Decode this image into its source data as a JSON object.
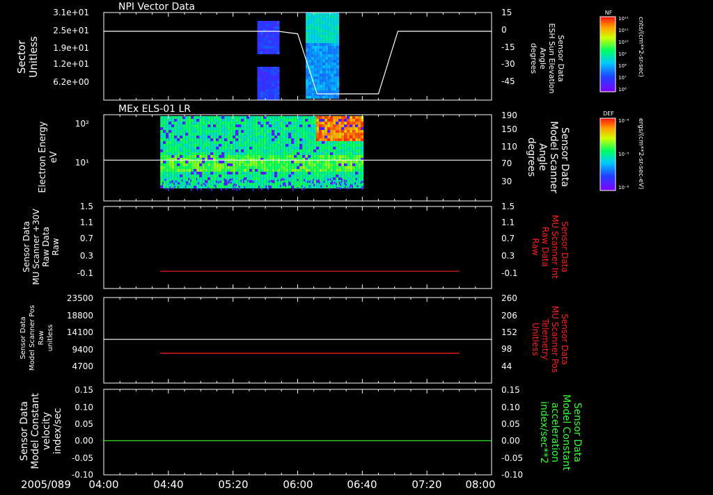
{
  "date_label": "2005/089",
  "colors": {
    "axis": "#ffffff",
    "red_trace": "#ff2020",
    "green_trace": "#33ff33",
    "white_trace": "#ffffff",
    "background": "#000000"
  },
  "chart_data": [
    {
      "id": "panel1",
      "type": "heatmap",
      "title": "NPI Vector Data",
      "ylabel_left": [
        "Sector",
        "Unitless"
      ],
      "ylabel_right": [
        "Sensor Data",
        "ESH Sun Elevation",
        "Angle",
        "degrees"
      ],
      "y_left_ticks": [
        "3.1e+01",
        "2.5e+01",
        "1.9e+01",
        "1.2e+01",
        "6.2e+00"
      ],
      "y_right_ticks": [
        "15",
        "0",
        "-15",
        "-30",
        "-45"
      ],
      "y_right_range": [
        -55,
        15
      ],
      "colorbar": {
        "tag": "NF",
        "unit": "cnts/(cm**2-sr-sec)",
        "ticks": [
          "10¹²",
          "10¹¹",
          "10¹⁰",
          "10⁹",
          "10⁸",
          "10⁷",
          "10⁶"
        ]
      },
      "line_series": {
        "name": "ESH Sun Elevation Angle",
        "x": [
          "04:00",
          "05:48",
          "06:00",
          "06:12",
          "06:50",
          "07:02",
          "08:00"
        ],
        "y": [
          0,
          0,
          -2,
          -50,
          -50,
          0,
          0
        ]
      }
    },
    {
      "id": "panel2",
      "type": "heatmap",
      "title": "MEx ELS-01 LR",
      "ylabel_left": [
        "Electron Energy",
        "eV"
      ],
      "ylabel_right": [
        "Sensor Data",
        "Model Scanner",
        "Angle",
        "degrees"
      ],
      "y_left_ticks": [
        "10²",
        "10¹"
      ],
      "y_left_scale": "log",
      "y_right_ticks": [
        "190",
        "150",
        "110",
        "70",
        "30"
      ],
      "y_right_range": [
        0,
        190
      ],
      "colorbar": {
        "tag": "DEF",
        "unit": "ergs/(cm**2-sr-sec-eV)",
        "ticks": [
          "10⁻⁴",
          "10⁻⁵",
          "10⁻⁶"
        ]
      },
      "line_series": {
        "name": "Model Scanner Angle",
        "x": [
          "04:00",
          "08:00"
        ],
        "y": [
          90,
          90
        ]
      }
    },
    {
      "id": "panel3",
      "type": "line",
      "ylabel_left": [
        "Sensor Data",
        "MU Scanner +30V",
        "Raw Data",
        "Raw"
      ],
      "ylabel_right": [
        "Sensor Data",
        "MU Scanner Int",
        "Raw Data",
        "Raw"
      ],
      "y_left_ticks": [
        "1.5",
        "1.1",
        "0.7",
        "0.3",
        "-0.1"
      ],
      "y_right_ticks": [
        "1.5",
        "1.1",
        "0.7",
        "0.3",
        "-0.1"
      ],
      "ylim": [
        -0.4,
        1.5
      ],
      "series": [
        {
          "color": "red",
          "x": [
            "04:35",
            "07:40"
          ],
          "y": [
            0.0,
            0.0
          ]
        }
      ]
    },
    {
      "id": "panel4",
      "type": "line",
      "ylabel_left": [
        "Sensor Data",
        "Model Scanner Pos",
        "Raw",
        "unitless"
      ],
      "ylabel_right": [
        "Sensor Data",
        "MU Scanner Pos",
        "Telemetry",
        "Unitless"
      ],
      "y_left_ticks": [
        "23500",
        "18800",
        "14100",
        "9400",
        "4700"
      ],
      "y_right_ticks": [
        "260",
        "206",
        "152",
        "98",
        "44"
      ],
      "ylim": [
        0,
        23500
      ],
      "y_right_range": [
        0,
        260
      ],
      "series": [
        {
          "color": "white",
          "x": [
            "04:00",
            "08:00"
          ],
          "y": [
            12000,
            12000
          ]
        },
        {
          "color": "red",
          "x": [
            "04:35",
            "07:40"
          ],
          "y": [
            8200,
            8200
          ]
        }
      ]
    },
    {
      "id": "panel5",
      "type": "line",
      "ylabel_left": [
        "Sensor Data",
        "Model Constant",
        "velocity",
        "index/sec"
      ],
      "ylabel_right": [
        "Sensor Data",
        "Model Constant",
        "acceleration",
        "index/sec**2"
      ],
      "y_left_ticks": [
        "0.15",
        "0.10",
        "0.05",
        "0.00",
        "-0.05",
        "-0.10"
      ],
      "y_right_ticks": [
        "0.15",
        "0.10",
        "0.05",
        "0.00",
        "-0.05",
        "-0.10"
      ],
      "ylim": [
        -0.1,
        0.15
      ],
      "series": [
        {
          "color": "green",
          "x": [
            "04:00",
            "08:00"
          ],
          "y": [
            0.0,
            0.0
          ]
        }
      ]
    }
  ],
  "x_axis": {
    "range": [
      "04:00",
      "08:00"
    ],
    "tick_labels": [
      "04:00",
      "04:40",
      "05:20",
      "06:00",
      "06:40",
      "07:20",
      "08:00"
    ]
  }
}
